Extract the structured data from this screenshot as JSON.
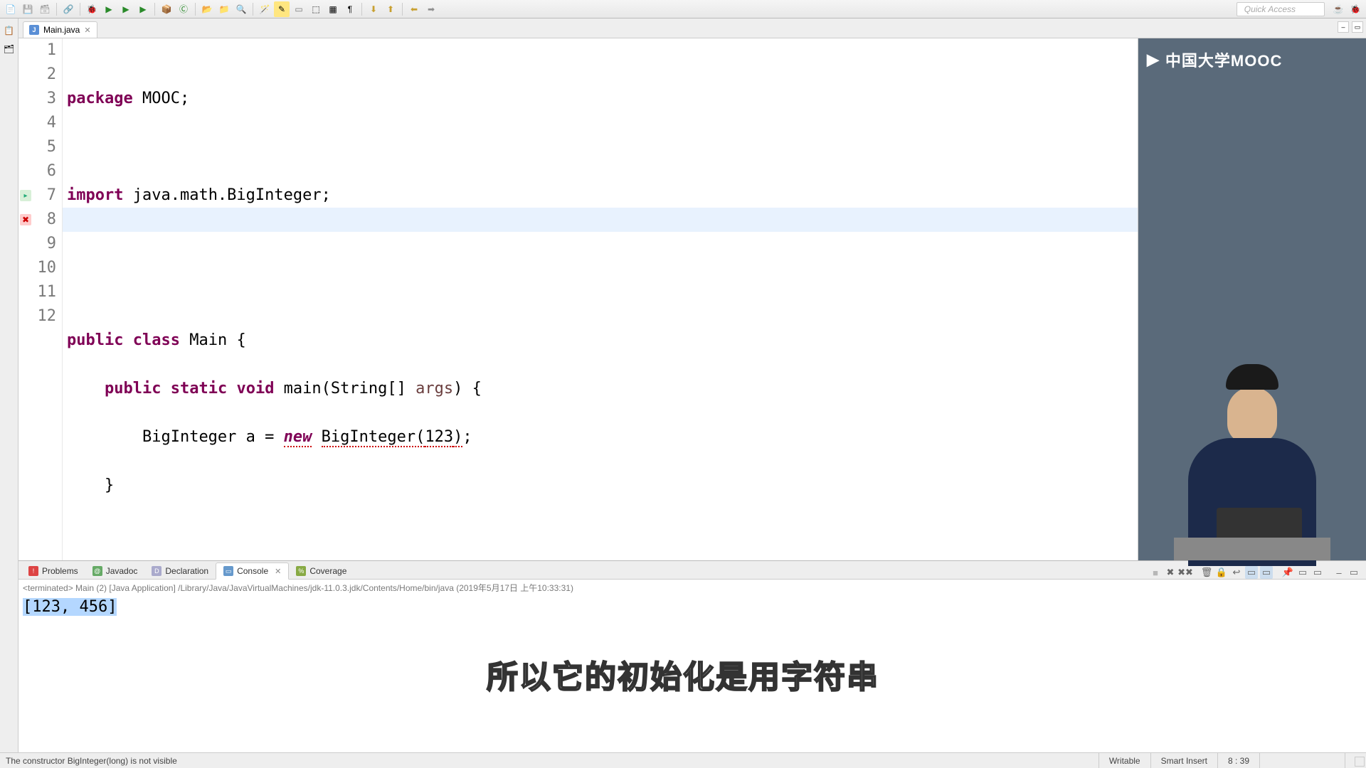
{
  "toolbar": {
    "quick_access": "Quick Access"
  },
  "tab": {
    "label": "Main.java"
  },
  "code": {
    "lines": [
      "1",
      "2",
      "3",
      "4",
      "5",
      "6",
      "7",
      "8",
      "9",
      "10",
      "11",
      "12"
    ],
    "l1_kw": "package",
    "l1_rest": " MOOC;",
    "l3_kw": "import",
    "l3_rest": " java.math.BigInteger;",
    "l6_kw1": "public",
    "l6_kw2": "class",
    "l6_rest": " Main {",
    "l7_ind": "    ",
    "l7_kw1": "public",
    "l7_kw2": "static",
    "l7_kw3": "void",
    "l7_m": " main(String[] ",
    "l7_args": "args",
    "l7_end": ") {",
    "l8_ind": "        ",
    "l8_a": "BigInteger a = ",
    "l8_new": "new",
    "l8_sp": " ",
    "l8_call": "BigInteger(",
    "l8_arg": "123",
    "l8_end": ");",
    "l9": "    }",
    "l11": "}"
  },
  "video_logo": "中国大学MOOC",
  "bottom": {
    "problems": "Problems",
    "javadoc": "Javadoc",
    "declaration": "Declaration",
    "console": "Console",
    "coverage": "Coverage",
    "terminated": "<terminated> Main (2) [Java Application] /Library/Java/JavaVirtualMachines/jdk-11.0.3.jdk/Contents/Home/bin/java (2019年5月17日 上午10:33:31)",
    "output": "[123, 456]"
  },
  "status": {
    "left": "The constructor BigInteger(long) is not visible",
    "writable": "Writable",
    "insert": "Smart Insert",
    "pos": "8 : 39"
  },
  "subtitle": "所以它的初始化是用字符串"
}
